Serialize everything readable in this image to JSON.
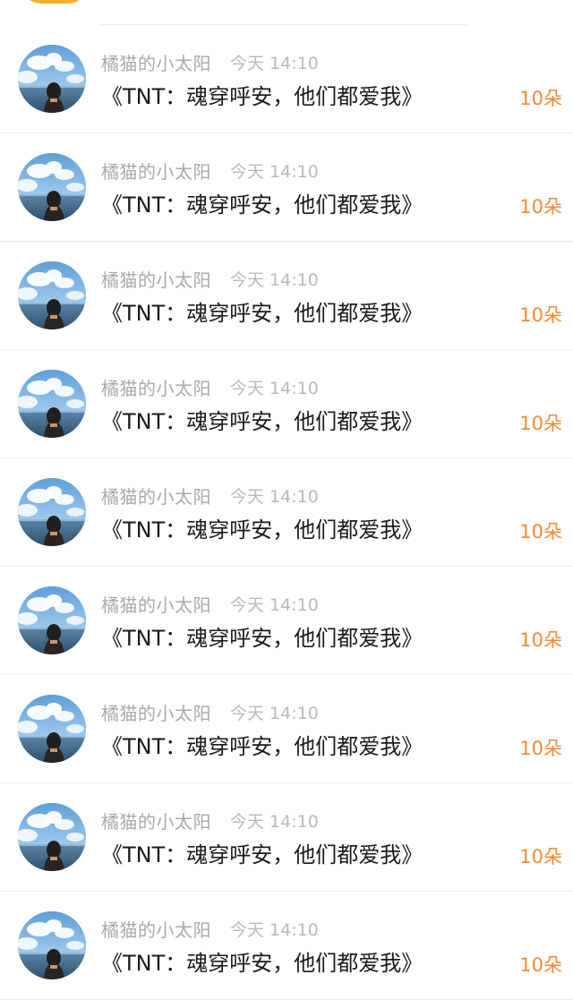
{
  "colors": {
    "background": "#ffffff",
    "name_text": "#a9a9a9",
    "time_text": "#b9b9b9",
    "title_text": "#1a1a1a",
    "amount_accent": "#f08a3a",
    "divider": "#ececec"
  },
  "rows": [
    {
      "avatar_icon": "avatar-sky-sea-photo",
      "username": "橘猫的小太阳",
      "time": "今天 14:10",
      "title": "《TNT：魂穿呼安，他们都爱我》",
      "amount": "10朵"
    },
    {
      "avatar_icon": "avatar-sky-sea-photo",
      "username": "橘猫的小太阳",
      "time": "今天 14:10",
      "title": "《TNT：魂穿呼安，他们都爱我》",
      "amount": "10朵"
    },
    {
      "avatar_icon": "avatar-sky-sea-photo",
      "username": "橘猫的小太阳",
      "time": "今天 14:10",
      "title": "《TNT：魂穿呼安，他们都爱我》",
      "amount": "10朵"
    },
    {
      "avatar_icon": "avatar-sky-sea-photo",
      "username": "橘猫的小太阳",
      "time": "今天 14:10",
      "title": "《TNT：魂穿呼安，他们都爱我》",
      "amount": "10朵"
    },
    {
      "avatar_icon": "avatar-sky-sea-photo",
      "username": "橘猫的小太阳",
      "time": "今天 14:10",
      "title": "《TNT：魂穿呼安，他们都爱我》",
      "amount": "10朵"
    },
    {
      "avatar_icon": "avatar-sky-sea-photo",
      "username": "橘猫的小太阳",
      "time": "今天 14:10",
      "title": "《TNT：魂穿呼安，他们都爱我》",
      "amount": "10朵"
    },
    {
      "avatar_icon": "avatar-sky-sea-photo",
      "username": "橘猫的小太阳",
      "time": "今天 14:10",
      "title": "《TNT：魂穿呼安，他们都爱我》",
      "amount": "10朵"
    },
    {
      "avatar_icon": "avatar-sky-sea-photo",
      "username": "橘猫的小太阳",
      "time": "今天 14:10",
      "title": "《TNT：魂穿呼安，他们都爱我》",
      "amount": "10朵"
    },
    {
      "avatar_icon": "avatar-sky-sea-photo",
      "username": "橘猫的小太阳",
      "time": "今天 14:10",
      "title": "《TNT：魂穿呼安，他们都爱我》",
      "amount": "10朵"
    }
  ]
}
